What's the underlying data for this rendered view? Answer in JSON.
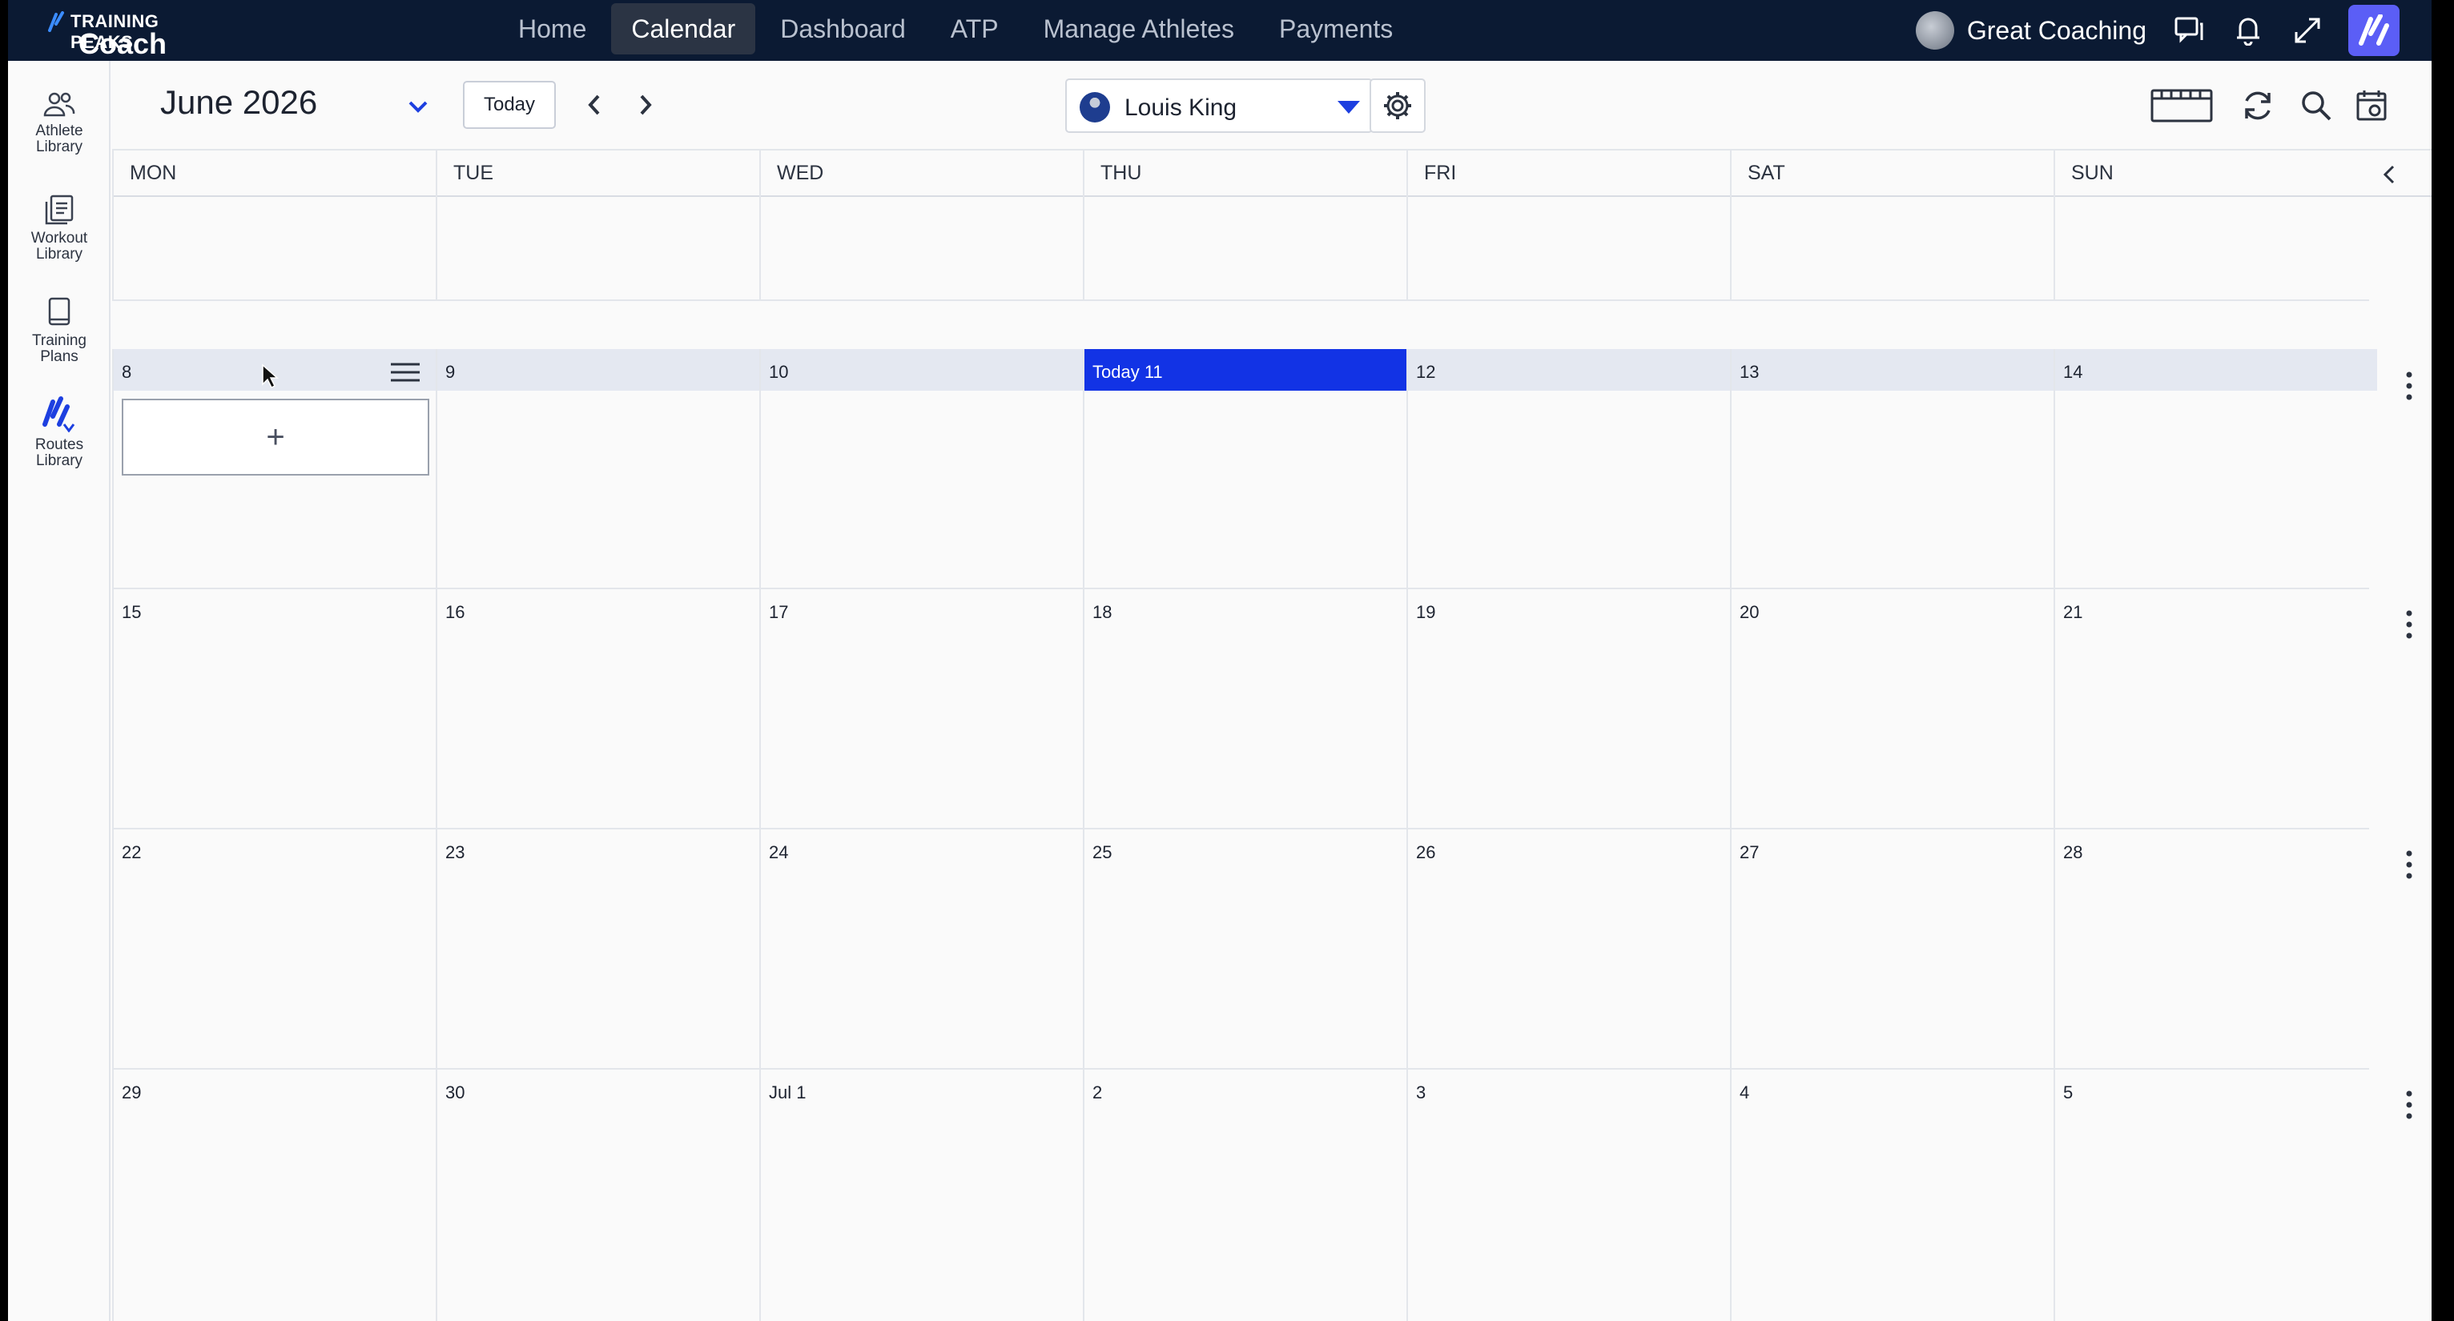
{
  "brand": {
    "top_text": "TRAINING PEAKS",
    "bottom_text": "Coach"
  },
  "nav": {
    "items": [
      {
        "label": "Home",
        "active": false
      },
      {
        "label": "Calendar",
        "active": true
      },
      {
        "label": "Dashboard",
        "active": false
      },
      {
        "label": "ATP",
        "active": false
      },
      {
        "label": "Manage Athletes",
        "active": false
      },
      {
        "label": "Payments",
        "active": false
      }
    ]
  },
  "topright": {
    "org_name": "Great Coaching",
    "icons": [
      "chat-icon",
      "bell-icon",
      "expand-icon",
      "trainingpeaks-logo"
    ]
  },
  "sidebar": {
    "items": [
      {
        "label": "Athlete\nLibrary",
        "icon": "people-icon"
      },
      {
        "label": "Workout\nLibrary",
        "icon": "document-stack-icon"
      },
      {
        "label": "Training\nPlans",
        "icon": "book-icon"
      },
      {
        "label": "Routes\nLibrary",
        "icon": "routes-icon"
      }
    ]
  },
  "calendar": {
    "month_label": "June 2026",
    "today_button": "Today",
    "athlete_name": "Louis King",
    "weekdays": [
      "MON",
      "TUE",
      "WED",
      "THU",
      "FRI",
      "SAT",
      "SUN"
    ],
    "add_workout_symbol": "+",
    "weeks": [
      {
        "days": [
          "",
          "",
          "",
          "",
          "",
          "",
          ""
        ],
        "current": false
      },
      {
        "days": [
          "8",
          "9",
          "10",
          "Today 11",
          "12",
          "13",
          "14"
        ],
        "current": true
      },
      {
        "days": [
          "15",
          "16",
          "17",
          "18",
          "19",
          "20",
          "21"
        ],
        "current": false
      },
      {
        "days": [
          "22",
          "23",
          "24",
          "25",
          "26",
          "27",
          "28"
        ],
        "current": false
      },
      {
        "days": [
          "29",
          "30",
          "Jul 1",
          "2",
          "3",
          "4",
          "5"
        ],
        "current": false
      }
    ]
  },
  "colors": {
    "topbar": "#0b1a33",
    "today_highlight": "#1233e5",
    "current_week_header": "#e4e8f1",
    "logo_accent": "#5b5ef6"
  }
}
